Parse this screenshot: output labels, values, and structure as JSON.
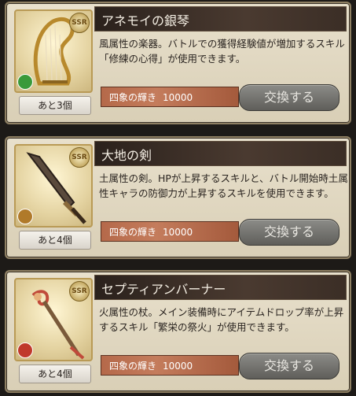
{
  "cards": [
    {
      "name": "アネモイの銀琴",
      "description": "風属性の楽器。バトルでの獲得経験値が増加するスキル「修練の心得」が使用できます。",
      "remaining": "あと3個",
      "cost_label": "四象の輝き",
      "cost_value": "10000",
      "button": "交換する",
      "rarity": "SSR",
      "element_color": "#3a9a3a",
      "icon": "harp-icon"
    },
    {
      "name": "大地の剣",
      "description": "土属性の剣。HPが上昇するスキルと、バトル開始時土属性キャラの防御力が上昇するスキルを使用できます。",
      "remaining": "あと4個",
      "cost_label": "四象の輝き",
      "cost_value": "10000",
      "button": "交換する",
      "rarity": "SSR",
      "element_color": "#b07a2a",
      "icon": "sword-icon"
    },
    {
      "name": "セプティアンバーナー",
      "description": "火属性の杖。メイン装備時にアイテムドロップ率が上昇するスキル「繁栄の祭火」が使用できます。",
      "remaining": "あと4個",
      "cost_label": "四象の輝き",
      "cost_value": "10000",
      "button": "交換する",
      "rarity": "SSR",
      "element_color": "#c0392b",
      "icon": "staff-icon"
    }
  ]
}
